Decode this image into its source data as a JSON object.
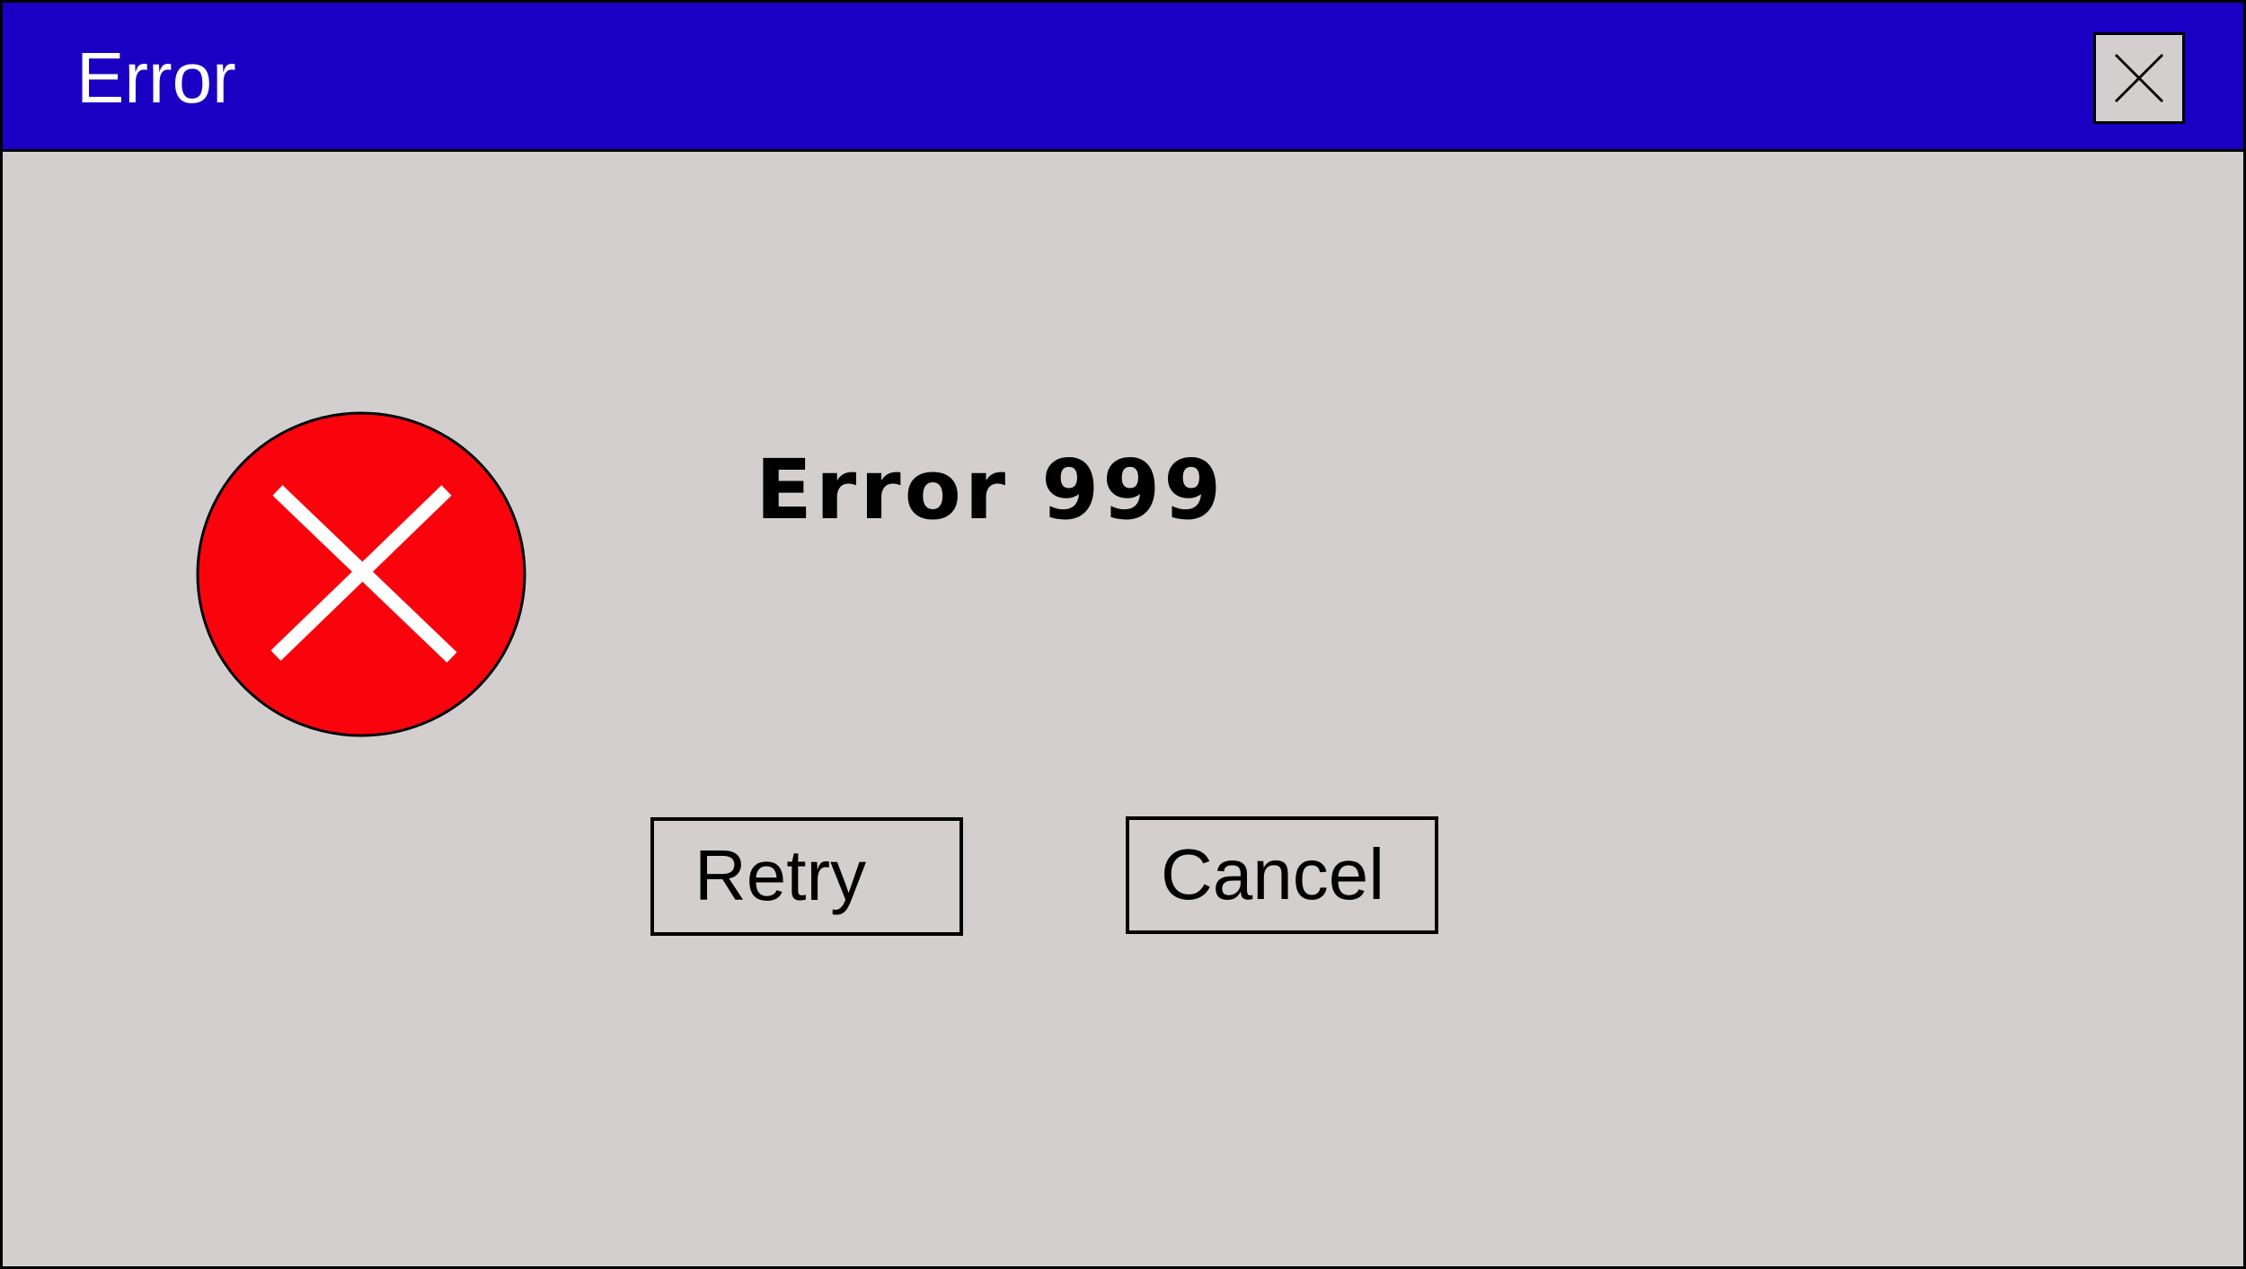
{
  "window": {
    "title": "Error",
    "close_icon": "close-icon"
  },
  "message": {
    "icon": "error-icon",
    "heading": "Error 999"
  },
  "buttons": {
    "retry_label": "Retry",
    "cancel_label": "Cancel"
  },
  "colors": {
    "titlebar": "#1a00c2",
    "background": "#d4cfcf",
    "error_icon": "#f9040d",
    "title_text": "#ffffff"
  }
}
